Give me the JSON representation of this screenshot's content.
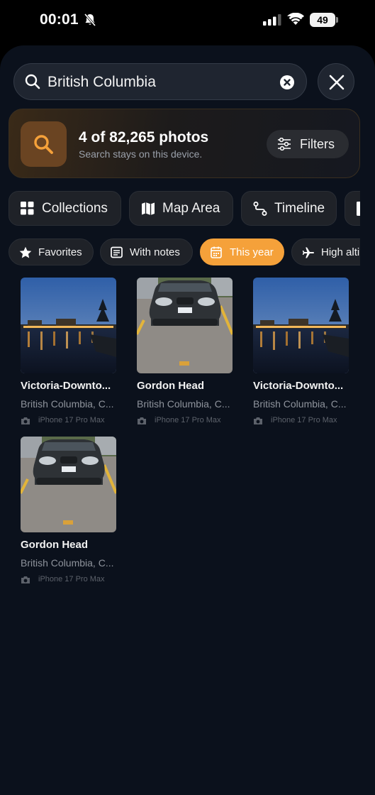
{
  "status_bar": {
    "time": "00:01",
    "battery": "49"
  },
  "search": {
    "query": "British Columbia"
  },
  "results": {
    "count_text": "4 of 82,265 photos",
    "subtitle": "Search stays on this device.",
    "filters_label": "Filters"
  },
  "categories": [
    {
      "label": "Collections",
      "icon": "grid-icon"
    },
    {
      "label": "Map Area",
      "icon": "map-icon"
    },
    {
      "label": "Timeline",
      "icon": "route-icon"
    }
  ],
  "pills": [
    {
      "label": "Favorites",
      "icon": "star-icon",
      "active": false
    },
    {
      "label": "With notes",
      "icon": "note-icon",
      "active": false
    },
    {
      "label": "This year",
      "icon": "calendar-icon",
      "active": true
    },
    {
      "label": "High alti",
      "icon": "airplane-icon",
      "active": false
    }
  ],
  "photos": [
    {
      "title": "Victoria-Downto...",
      "location": "British Columbia, C...",
      "device": "iPhone 17 Pro Max",
      "kind": "harbour"
    },
    {
      "title": "Gordon Head",
      "location": "British Columbia, C...",
      "device": "iPhone 17 Pro Max",
      "kind": "car"
    },
    {
      "title": "Victoria-Downto...",
      "location": "British Columbia, C...",
      "device": "iPhone 17 Pro Max",
      "kind": "harbour"
    },
    {
      "title": "Gordon Head",
      "location": "British Columbia, C...",
      "device": "iPhone 17 Pro Max",
      "kind": "car"
    }
  ],
  "colors": {
    "accent": "#f5a13a",
    "background": "#0b111c"
  }
}
